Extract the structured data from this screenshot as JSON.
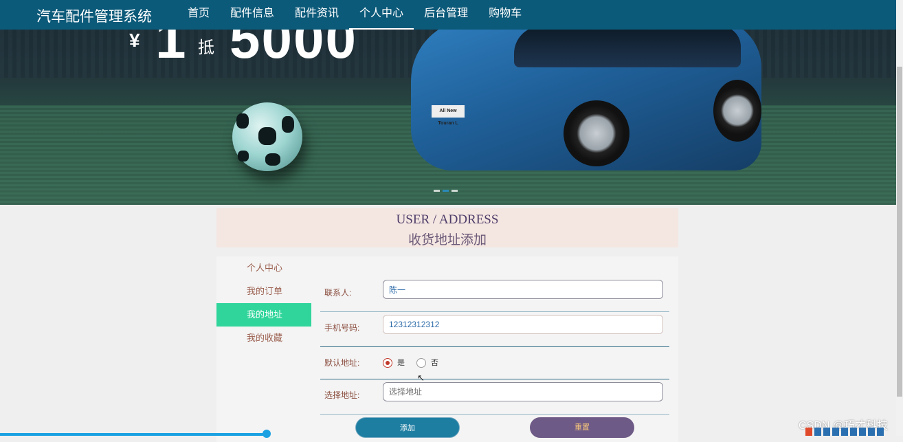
{
  "brand": "汽车配件管理系统",
  "nav": [
    {
      "label": "首页"
    },
    {
      "label": "配件信息"
    },
    {
      "label": "配件资讯"
    },
    {
      "label": "个人中心"
    },
    {
      "label": "后台管理"
    },
    {
      "label": "购物车"
    }
  ],
  "banner": {
    "promo_currency": "¥",
    "promo_value": "1",
    "promo_di": "抵",
    "promo_amount": "5000",
    "car_plate": "All New Touran L",
    "active_slide": 2,
    "slide_count": 3
  },
  "title": {
    "en": "USER / ADDRESS",
    "cn": "收货地址添加"
  },
  "side_menu": [
    {
      "label": "个人中心"
    },
    {
      "label": "我的订单"
    },
    {
      "label": "我的地址",
      "active": true
    },
    {
      "label": "我的收藏"
    }
  ],
  "form": {
    "contact_label": "联系人:",
    "contact_value": "陈一",
    "phone_label": "手机号码:",
    "phone_value": "12312312312",
    "default_label": "默认地址:",
    "default_yes": "是",
    "default_no": "否",
    "default_selected": "是",
    "address_label": "选择地址:",
    "address_placeholder": "选择地址",
    "add_button": "添加",
    "reset_button": "重置"
  },
  "watermark": "CSDN @巧才科技",
  "colors": {
    "navbar": "#0c5a7a",
    "menu_active": "#2fd59b",
    "add_button": "#1e7ea2",
    "reset_button": "#6e5a86",
    "title_bg": "#f4e6e1"
  }
}
